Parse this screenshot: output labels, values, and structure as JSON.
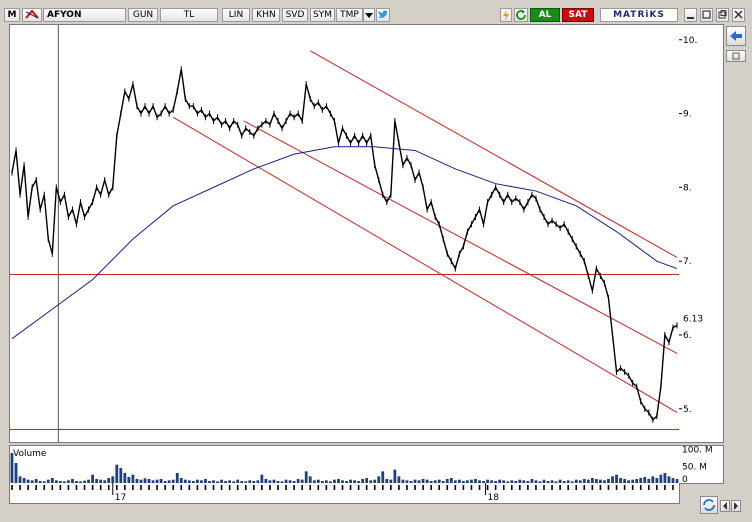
{
  "toolbar": {
    "m_label": "M",
    "symbol": "AFYON",
    "buttons": [
      "GUN",
      "TL",
      "LIN",
      "KHN",
      "SVD",
      "SYM",
      "TMP"
    ],
    "buy_label": "AL",
    "sell_label": "SAT",
    "brand": "MATRiKS"
  },
  "colors": {
    "price": "#000000",
    "ma": "#1c1c8a",
    "channel": "#cc2222",
    "volume": "#1f3f7f",
    "buy": "#1a8a1a",
    "sell": "#c41010"
  },
  "chart_data": {
    "type": "line",
    "y_ticks": [
      {
        "value": 10,
        "label": "10."
      },
      {
        "value": 9,
        "label": "9."
      },
      {
        "value": 8,
        "label": "8."
      },
      {
        "value": 7,
        "label": "7."
      },
      {
        "value": 6,
        "label": "6."
      },
      {
        "value": 5,
        "label": "5."
      }
    ],
    "ylim": [
      4.55,
      10.2
    ],
    "last_price": {
      "value": 6.13,
      "label": "6.13"
    },
    "x_ticks": [
      {
        "label": "17",
        "x": 100
      },
      {
        "label": "18",
        "x": 470
      }
    ],
    "xlim": [
      0,
      660
    ],
    "price": [
      [
        0,
        8.2
      ],
      [
        4,
        8.5
      ],
      [
        8,
        7.9
      ],
      [
        12,
        8.3
      ],
      [
        16,
        7.6
      ],
      [
        20,
        8.0
      ],
      [
        24,
        8.1
      ],
      [
        28,
        7.7
      ],
      [
        32,
        7.9
      ],
      [
        36,
        7.3
      ],
      [
        40,
        7.1
      ],
      [
        44,
        8.0
      ],
      [
        48,
        7.8
      ],
      [
        52,
        7.9
      ],
      [
        56,
        7.6
      ],
      [
        60,
        7.7
      ],
      [
        64,
        7.5
      ],
      [
        68,
        7.8
      ],
      [
        72,
        7.6
      ],
      [
        76,
        7.7
      ],
      [
        80,
        7.8
      ],
      [
        84,
        8.0
      ],
      [
        88,
        7.9
      ],
      [
        92,
        8.1
      ],
      [
        96,
        7.9
      ],
      [
        100,
        8.0
      ],
      [
        104,
        8.7
      ],
      [
        108,
        9.0
      ],
      [
        112,
        9.3
      ],
      [
        116,
        9.2
      ],
      [
        120,
        9.4
      ],
      [
        124,
        9.1
      ],
      [
        128,
        9.0
      ],
      [
        132,
        9.1
      ],
      [
        136,
        9.0
      ],
      [
        140,
        9.1
      ],
      [
        144,
        8.95
      ],
      [
        148,
        9.0
      ],
      [
        152,
        9.1
      ],
      [
        156,
        9.0
      ],
      [
        160,
        9.05
      ],
      [
        164,
        9.3
      ],
      [
        168,
        9.6
      ],
      [
        172,
        9.2
      ],
      [
        176,
        9.1
      ],
      [
        180,
        9.1
      ],
      [
        184,
        9.0
      ],
      [
        188,
        9.05
      ],
      [
        192,
        8.95
      ],
      [
        196,
        9.0
      ],
      [
        200,
        8.9
      ],
      [
        204,
        8.95
      ],
      [
        208,
        8.85
      ],
      [
        212,
        8.9
      ],
      [
        216,
        8.8
      ],
      [
        220,
        8.9
      ],
      [
        224,
        8.85
      ],
      [
        228,
        8.7
      ],
      [
        232,
        8.8
      ],
      [
        236,
        8.75
      ],
      [
        240,
        8.7
      ],
      [
        244,
        8.8
      ],
      [
        248,
        8.85
      ],
      [
        252,
        8.9
      ],
      [
        256,
        8.85
      ],
      [
        260,
        9.0
      ],
      [
        264,
        8.9
      ],
      [
        268,
        8.8
      ],
      [
        272,
        8.9
      ],
      [
        276,
        9.0
      ],
      [
        280,
        8.95
      ],
      [
        284,
        9.0
      ],
      [
        288,
        8.9
      ],
      [
        292,
        9.4
      ],
      [
        296,
        9.2
      ],
      [
        300,
        9.1
      ],
      [
        304,
        9.15
      ],
      [
        308,
        9.05
      ],
      [
        312,
        9.1
      ],
      [
        316,
        9.0
      ],
      [
        320,
        8.9
      ],
      [
        324,
        8.6
      ],
      [
        328,
        8.8
      ],
      [
        332,
        8.7
      ],
      [
        336,
        8.6
      ],
      [
        340,
        8.7
      ],
      [
        344,
        8.6
      ],
      [
        348,
        8.7
      ],
      [
        352,
        8.6
      ],
      [
        356,
        8.7
      ],
      [
        360,
        8.3
      ],
      [
        364,
        8.1
      ],
      [
        368,
        7.9
      ],
      [
        372,
        7.8
      ],
      [
        376,
        7.9
      ],
      [
        380,
        8.9
      ],
      [
        384,
        8.6
      ],
      [
        388,
        8.3
      ],
      [
        392,
        8.4
      ],
      [
        396,
        8.3
      ],
      [
        400,
        8.1
      ],
      [
        404,
        8.2
      ],
      [
        408,
        8.0
      ],
      [
        412,
        7.7
      ],
      [
        416,
        7.8
      ],
      [
        420,
        7.6
      ],
      [
        424,
        7.5
      ],
      [
        428,
        7.3
      ],
      [
        432,
        7.1
      ],
      [
        436,
        7.0
      ],
      [
        440,
        6.9
      ],
      [
        444,
        7.1
      ],
      [
        448,
        7.2
      ],
      [
        452,
        7.4
      ],
      [
        456,
        7.5
      ],
      [
        460,
        7.6
      ],
      [
        464,
        7.7
      ],
      [
        468,
        7.5
      ],
      [
        472,
        7.8
      ],
      [
        476,
        7.9
      ],
      [
        480,
        8.0
      ],
      [
        484,
        7.9
      ],
      [
        488,
        7.8
      ],
      [
        492,
        7.9
      ],
      [
        496,
        7.8
      ],
      [
        500,
        7.85
      ],
      [
        504,
        7.8
      ],
      [
        508,
        7.7
      ],
      [
        512,
        7.8
      ],
      [
        516,
        7.9
      ],
      [
        520,
        7.85
      ],
      [
        524,
        7.7
      ],
      [
        528,
        7.6
      ],
      [
        532,
        7.5
      ],
      [
        536,
        7.55
      ],
      [
        540,
        7.5
      ],
      [
        544,
        7.45
      ],
      [
        548,
        7.5
      ],
      [
        552,
        7.4
      ],
      [
        556,
        7.3
      ],
      [
        560,
        7.2
      ],
      [
        564,
        7.1
      ],
      [
        568,
        7.0
      ],
      [
        572,
        6.8
      ],
      [
        576,
        6.6
      ],
      [
        580,
        6.9
      ],
      [
        584,
        6.8
      ],
      [
        588,
        6.7
      ],
      [
        592,
        6.5
      ],
      [
        596,
        6.0
      ],
      [
        600,
        5.5
      ],
      [
        604,
        5.55
      ],
      [
        608,
        5.5
      ],
      [
        612,
        5.45
      ],
      [
        616,
        5.35
      ],
      [
        620,
        5.3
      ],
      [
        624,
        5.1
      ],
      [
        628,
        5.0
      ],
      [
        632,
        4.95
      ],
      [
        636,
        4.85
      ],
      [
        640,
        4.9
      ],
      [
        644,
        5.3
      ],
      [
        648,
        6.0
      ],
      [
        652,
        5.9
      ],
      [
        656,
        6.1
      ],
      [
        660,
        6.13
      ]
    ],
    "moving_average": [
      [
        0,
        5.95
      ],
      [
        40,
        6.35
      ],
      [
        80,
        6.75
      ],
      [
        120,
        7.3
      ],
      [
        160,
        7.75
      ],
      [
        200,
        8.0
      ],
      [
        240,
        8.25
      ],
      [
        280,
        8.45
      ],
      [
        320,
        8.55
      ],
      [
        360,
        8.55
      ],
      [
        400,
        8.5
      ],
      [
        440,
        8.25
      ],
      [
        480,
        8.05
      ],
      [
        520,
        7.95
      ],
      [
        560,
        7.75
      ],
      [
        600,
        7.4
      ],
      [
        640,
        7.0
      ],
      [
        660,
        6.9
      ]
    ],
    "channel_lines": [
      {
        "from": [
          160,
          8.95
        ],
        "to": [
          660,
          4.95
        ]
      },
      {
        "from": [
          296,
          9.85
        ],
        "to": [
          660,
          7.05
        ]
      },
      {
        "from": [
          230,
          8.9
        ],
        "to": [
          660,
          5.75
        ]
      }
    ],
    "horizontal_lines": [
      6.82,
      4.72
    ],
    "cursor_x": 46,
    "volume_label": "Volume",
    "volume_ticks": [
      {
        "value": 100,
        "label": "100. M"
      },
      {
        "value": 50,
        "label": "50. M"
      },
      {
        "value": 0,
        "label": "0"
      }
    ],
    "volume": [
      [
        0,
        90
      ],
      [
        4,
        60
      ],
      [
        8,
        20
      ],
      [
        12,
        15
      ],
      [
        16,
        10
      ],
      [
        20,
        8
      ],
      [
        24,
        12
      ],
      [
        28,
        6
      ],
      [
        32,
        5
      ],
      [
        36,
        10
      ],
      [
        40,
        15
      ],
      [
        44,
        8
      ],
      [
        48,
        6
      ],
      [
        52,
        5
      ],
      [
        56,
        8
      ],
      [
        60,
        12
      ],
      [
        64,
        6
      ],
      [
        68,
        5
      ],
      [
        72,
        7
      ],
      [
        76,
        10
      ],
      [
        80,
        25
      ],
      [
        84,
        12
      ],
      [
        88,
        10
      ],
      [
        92,
        8
      ],
      [
        96,
        15
      ],
      [
        100,
        20
      ],
      [
        104,
        55
      ],
      [
        108,
        45
      ],
      [
        112,
        30
      ],
      [
        116,
        18
      ],
      [
        120,
        25
      ],
      [
        124,
        12
      ],
      [
        128,
        10
      ],
      [
        132,
        14
      ],
      [
        136,
        12
      ],
      [
        140,
        8
      ],
      [
        144,
        10
      ],
      [
        148,
        12
      ],
      [
        152,
        6
      ],
      [
        156,
        8
      ],
      [
        160,
        10
      ],
      [
        164,
        30
      ],
      [
        168,
        15
      ],
      [
        172,
        10
      ],
      [
        176,
        8
      ],
      [
        180,
        6
      ],
      [
        184,
        10
      ],
      [
        188,
        8
      ],
      [
        192,
        12
      ],
      [
        196,
        6
      ],
      [
        200,
        8
      ],
      [
        204,
        5
      ],
      [
        208,
        10
      ],
      [
        212,
        6
      ],
      [
        216,
        8
      ],
      [
        220,
        5
      ],
      [
        224,
        10
      ],
      [
        228,
        6
      ],
      [
        232,
        5
      ],
      [
        236,
        8
      ],
      [
        240,
        6
      ],
      [
        244,
        8
      ],
      [
        248,
        25
      ],
      [
        252,
        12
      ],
      [
        256,
        8
      ],
      [
        260,
        10
      ],
      [
        264,
        6
      ],
      [
        268,
        5
      ],
      [
        272,
        10
      ],
      [
        276,
        8
      ],
      [
        280,
        6
      ],
      [
        284,
        12
      ],
      [
        288,
        10
      ],
      [
        292,
        35
      ],
      [
        296,
        20
      ],
      [
        300,
        8
      ],
      [
        304,
        10
      ],
      [
        308,
        6
      ],
      [
        312,
        8
      ],
      [
        316,
        5
      ],
      [
        320,
        10
      ],
      [
        324,
        12
      ],
      [
        328,
        8
      ],
      [
        332,
        6
      ],
      [
        336,
        10
      ],
      [
        340,
        8
      ],
      [
        344,
        6
      ],
      [
        348,
        12
      ],
      [
        352,
        15
      ],
      [
        356,
        8
      ],
      [
        360,
        10
      ],
      [
        364,
        20
      ],
      [
        368,
        35
      ],
      [
        372,
        12
      ],
      [
        376,
        10
      ],
      [
        380,
        40
      ],
      [
        384,
        20
      ],
      [
        388,
        10
      ],
      [
        392,
        8
      ],
      [
        396,
        6
      ],
      [
        400,
        10
      ],
      [
        404,
        8
      ],
      [
        408,
        12
      ],
      [
        412,
        10
      ],
      [
        416,
        6
      ],
      [
        420,
        8
      ],
      [
        424,
        10
      ],
      [
        428,
        6
      ],
      [
        432,
        12
      ],
      [
        436,
        15
      ],
      [
        440,
        8
      ],
      [
        444,
        10
      ],
      [
        448,
        6
      ],
      [
        452,
        8
      ],
      [
        456,
        10
      ],
      [
        460,
        12
      ],
      [
        464,
        8
      ],
      [
        468,
        6
      ],
      [
        472,
        10
      ],
      [
        476,
        8
      ],
      [
        480,
        6
      ],
      [
        484,
        10
      ],
      [
        488,
        8
      ],
      [
        492,
        5
      ],
      [
        496,
        8
      ],
      [
        500,
        6
      ],
      [
        504,
        10
      ],
      [
        508,
        8
      ],
      [
        512,
        6
      ],
      [
        516,
        12
      ],
      [
        520,
        8
      ],
      [
        524,
        5
      ],
      [
        528,
        10
      ],
      [
        532,
        6
      ],
      [
        536,
        8
      ],
      [
        540,
        5
      ],
      [
        544,
        10
      ],
      [
        548,
        6
      ],
      [
        552,
        8
      ],
      [
        556,
        5
      ],
      [
        560,
        10
      ],
      [
        564,
        8
      ],
      [
        568,
        12
      ],
      [
        572,
        10
      ],
      [
        576,
        15
      ],
      [
        580,
        12
      ],
      [
        584,
        10
      ],
      [
        588,
        8
      ],
      [
        592,
        12
      ],
      [
        596,
        20
      ],
      [
        600,
        25
      ],
      [
        604,
        15
      ],
      [
        608,
        12
      ],
      [
        612,
        8
      ],
      [
        616,
        10
      ],
      [
        620,
        12
      ],
      [
        624,
        15
      ],
      [
        628,
        18
      ],
      [
        632,
        12
      ],
      [
        636,
        20
      ],
      [
        640,
        15
      ],
      [
        644,
        25
      ],
      [
        648,
        30
      ],
      [
        652,
        20
      ],
      [
        656,
        15
      ],
      [
        660,
        12
      ]
    ]
  }
}
